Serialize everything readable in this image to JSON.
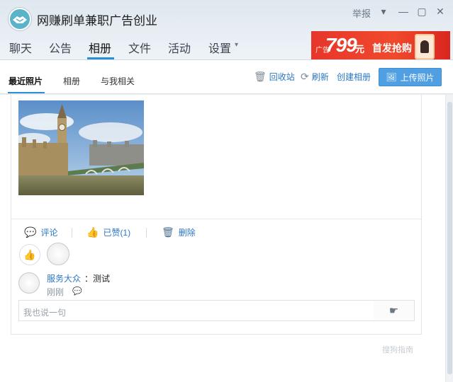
{
  "header": {
    "group_name": "网赚刷单兼职广告创业",
    "report": "举报",
    "controls": {
      "dropdown": "▾",
      "minimize": "—",
      "maximize": "▢",
      "close": "✕"
    }
  },
  "tabs": [
    {
      "label": "聊天"
    },
    {
      "label": "公告"
    },
    {
      "label": "相册"
    },
    {
      "label": "文件"
    },
    {
      "label": "活动"
    },
    {
      "label": "设置"
    }
  ],
  "settings_caret": "▾",
  "ad": {
    "label": "广告",
    "price": "799",
    "unit": "元",
    "text": "首发抢购"
  },
  "album": {
    "subtabs": [
      {
        "label": "最近照片"
      },
      {
        "label": "相册"
      },
      {
        "label": "与我相关"
      }
    ],
    "tools": {
      "recycle": "回收站",
      "refresh": "刷新",
      "create": "创建相册",
      "upload": "上传照片"
    }
  },
  "post": {
    "actions": {
      "comment": "评论",
      "liked": "已赞(1)",
      "delete": "删除"
    },
    "comment": {
      "user": "服务大众",
      "text": "：测试",
      "time": "刚刚"
    },
    "input_placeholder": "我也说一句"
  },
  "watermark": "搜狗指南",
  "icons": {
    "recycle": "trash-icon",
    "refresh": "refresh-icon",
    "upload": "image-upload-icon",
    "comment": "comment-icon",
    "like": "thumbs-up-icon",
    "delete": "trash-icon",
    "send": "pointer-hand-icon"
  }
}
